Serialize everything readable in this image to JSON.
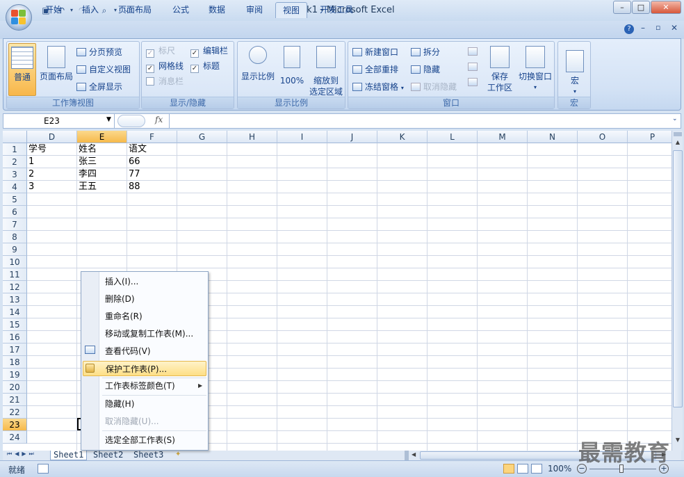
{
  "title": "Book1 - Microsoft Excel",
  "qat": {
    "save_icon": "save-icon",
    "undo_icon": "undo-icon",
    "redo_icon": "redo-icon",
    "preview_icon": "print-preview-icon"
  },
  "tabs": [
    "开始",
    "插入",
    "页面布局",
    "公式",
    "数据",
    "审阅",
    "视图",
    "开发工具"
  ],
  "active_tab": "视图",
  "ribbon": {
    "workbook_views": {
      "label": "工作簿视图",
      "normal": "普通",
      "page_layout": "页面布局",
      "page_break": "分页预览",
      "custom_views": "自定义视图",
      "full_screen": "全屏显示"
    },
    "show_hide": {
      "label": "显示/隐藏",
      "ruler": "标尺",
      "gridlines": "网格线",
      "message_bar": "消息栏",
      "formula_bar": "编辑栏",
      "headings": "标题"
    },
    "zoom": {
      "label": "显示比例",
      "zoom": "显示比例",
      "hundred": "100%",
      "zoom_to_sel_1": "缩放到",
      "zoom_to_sel_2": "选定区域"
    },
    "window": {
      "label": "窗口",
      "new_window": "新建窗口",
      "arrange_all": "全部重排",
      "freeze": "冻结窗格",
      "split": "拆分",
      "hide": "隐藏",
      "unhide": "取消隐藏",
      "save_ws_1": "保存",
      "save_ws_2": "工作区",
      "switch_1": "切换窗口"
    },
    "macro": {
      "label": "宏",
      "macro": "宏"
    }
  },
  "formula_bar": {
    "name_box": "E23",
    "fx": "fx",
    "content": ""
  },
  "columns": [
    "D",
    "E",
    "F",
    "G",
    "H",
    "I",
    "J",
    "K",
    "L",
    "M",
    "N",
    "O",
    "P"
  ],
  "selected_column": "E",
  "rows": [
    "1",
    "2",
    "3",
    "4",
    "5",
    "6",
    "7",
    "8",
    "9",
    "10",
    "11",
    "12",
    "13",
    "14",
    "15",
    "16",
    "17",
    "18",
    "19",
    "20",
    "21",
    "22",
    "23",
    "24"
  ],
  "selected_row": "23",
  "cells": {
    "D1": "学号",
    "E1": "姓名",
    "F1": "语文",
    "D2": "1",
    "E2": "张三",
    "F2": "66",
    "D3": "2",
    "E3": "李四",
    "F3": "77",
    "D4": "3",
    "E4": "王五",
    "F4": "88"
  },
  "sheets": [
    "Sheet1",
    "Sheet2",
    "Sheet3"
  ],
  "active_sheet": "Sheet1",
  "context_menu": [
    {
      "label": "插入(I)...",
      "disabled": false
    },
    {
      "label": "删除(D)",
      "disabled": false
    },
    {
      "label": "重命名(R)",
      "disabled": false
    },
    {
      "label": "移动或复制工作表(M)...",
      "disabled": false
    },
    {
      "label": "查看代码(V)",
      "disabled": false,
      "icon": "view-code-icon"
    },
    {
      "label": "保护工作表(P)...",
      "disabled": false,
      "icon": "protect-sheet-icon",
      "highlighted": true
    },
    {
      "label": "工作表标签颜色(T)",
      "disabled": false,
      "submenu": true
    },
    {
      "label": "隐藏(H)",
      "disabled": false
    },
    {
      "label": "取消隐藏(U)...",
      "disabled": true
    },
    {
      "label": "选定全部工作表(S)",
      "disabled": false
    }
  ],
  "status": {
    "mode": "就绪",
    "zoom": "100%"
  },
  "watermark": "最需教育",
  "colors": {
    "accent": "#f6b94b",
    "ribbon": "#dbe7f7",
    "selection": "#fddf85"
  }
}
